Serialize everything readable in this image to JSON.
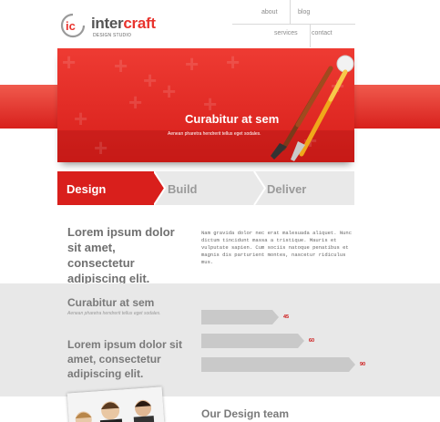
{
  "brand": {
    "name_part1": "inter",
    "name_part2": "craft",
    "tagline": "DESIGN STUDIO",
    "mark": "ic",
    "accent": "#e8332d"
  },
  "nav": [
    {
      "label": "about"
    },
    {
      "label": "blog"
    },
    {
      "label": "services"
    },
    {
      "label": "contact"
    }
  ],
  "hero": {
    "title": "Curabitur at sem",
    "subtitle": "Aenean pharetra hendrerit tellus eget sodales."
  },
  "steps": [
    {
      "label": "Design",
      "active": true
    },
    {
      "label": "Build",
      "active": false
    },
    {
      "label": "Deliver",
      "active": false
    }
  ],
  "intro": {
    "heading": "Lorem ipsum dolor sit amet, consectetur adipiscing elit.",
    "body": "Nam gravida dolor nec erat malesuada aliquet. Nunc dictum tincidunt massa a tristique. Mauris et vulputate sapien. Cum sociis natoque penatibus et magnis dis parturient montes, nascetur ridiculus mus."
  },
  "stats": {
    "heading": "Curabitur at sem",
    "subheading": "Aenean pharetra hendrerit tellus eget sodales.",
    "heading2": "Lorem ipsum dolor sit amet, consectetur adipiscing elit.",
    "bars": [
      {
        "value": 45,
        "label": "45"
      },
      {
        "value": 60,
        "label": "60"
      },
      {
        "value": 90,
        "label": "90"
      }
    ]
  },
  "team": {
    "title": "Our Design team"
  }
}
